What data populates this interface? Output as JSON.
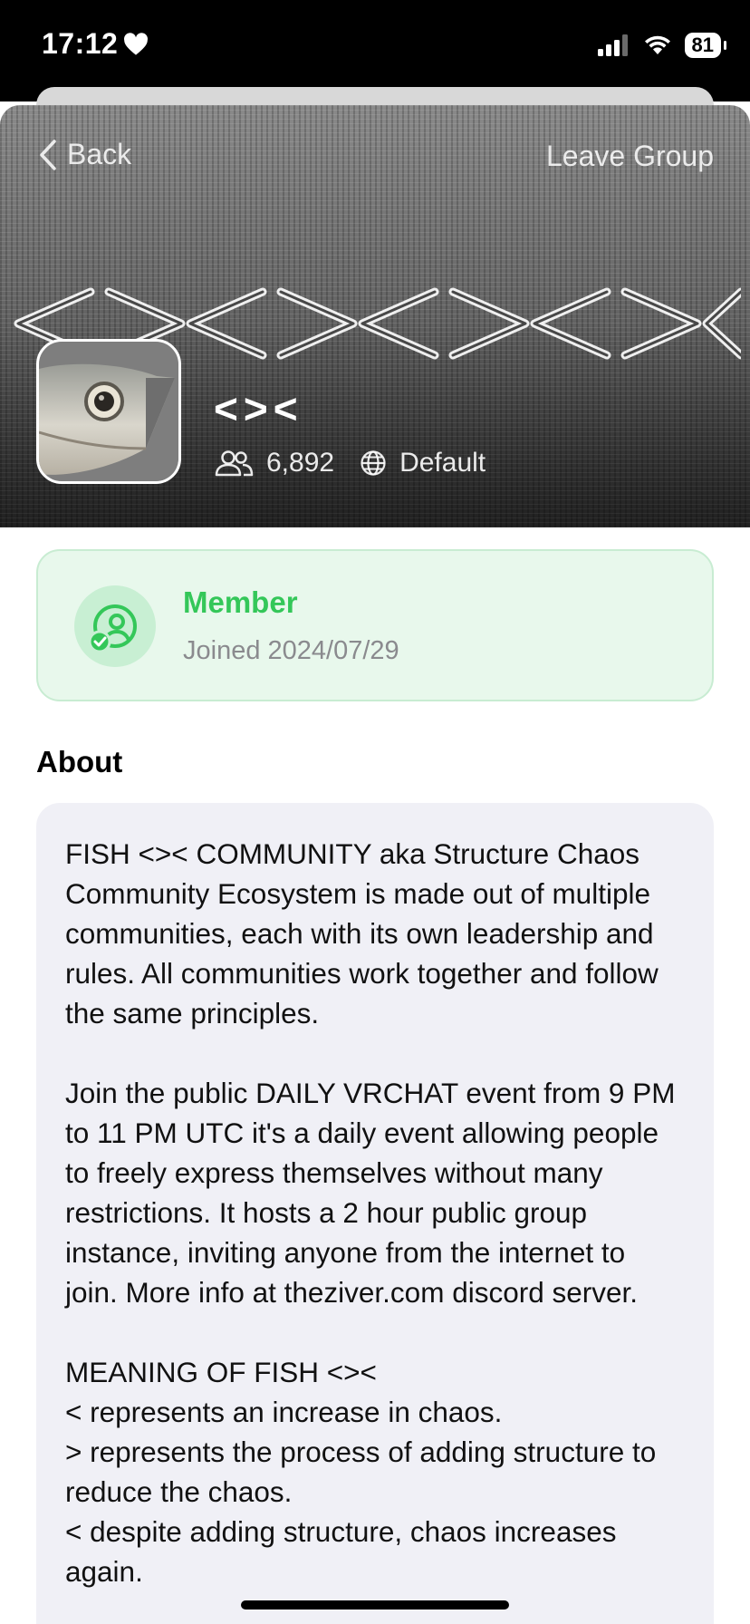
{
  "status_bar": {
    "time": "17:12",
    "battery": "81"
  },
  "nav": {
    "back_label": "Back",
    "leave_label": "Leave Group"
  },
  "group": {
    "name": "<><",
    "member_count": "6,892",
    "language": "Default"
  },
  "membership": {
    "role": "Member",
    "joined": "Joined 2024/07/29"
  },
  "about": {
    "heading": "About",
    "text": "FISH <>< COMMUNITY aka Structure Chaos Community Ecosystem is made out of multiple communities, each with its own leadership and rules. All communities work together and follow the same principles.\n\nJoin the public DAILY VRCHAT event from 9 PM to 11 PM UTC it's a daily event allowing people to freely express themselves without many restrictions. It hosts a 2 hour public group instance, inviting anyone from the internet to join. More info at theziver.com discord server.\n\nMEANING OF FISH <><\n< represents an increase in chaos.\n> represents the process of adding structure to reduce the chaos.\n< despite adding structure, chaos increases again."
  },
  "colors": {
    "accent_green": "#34c759",
    "member_card_bg": "#e8f8ec",
    "about_card_bg": "#f0f0f6"
  },
  "icons": {
    "heart": "heart-icon",
    "signal": "signal-icon",
    "wifi": "wifi-icon",
    "back": "chevron-left-icon",
    "members": "people-icon",
    "language": "globe-icon",
    "membership": "member-check-icon"
  }
}
